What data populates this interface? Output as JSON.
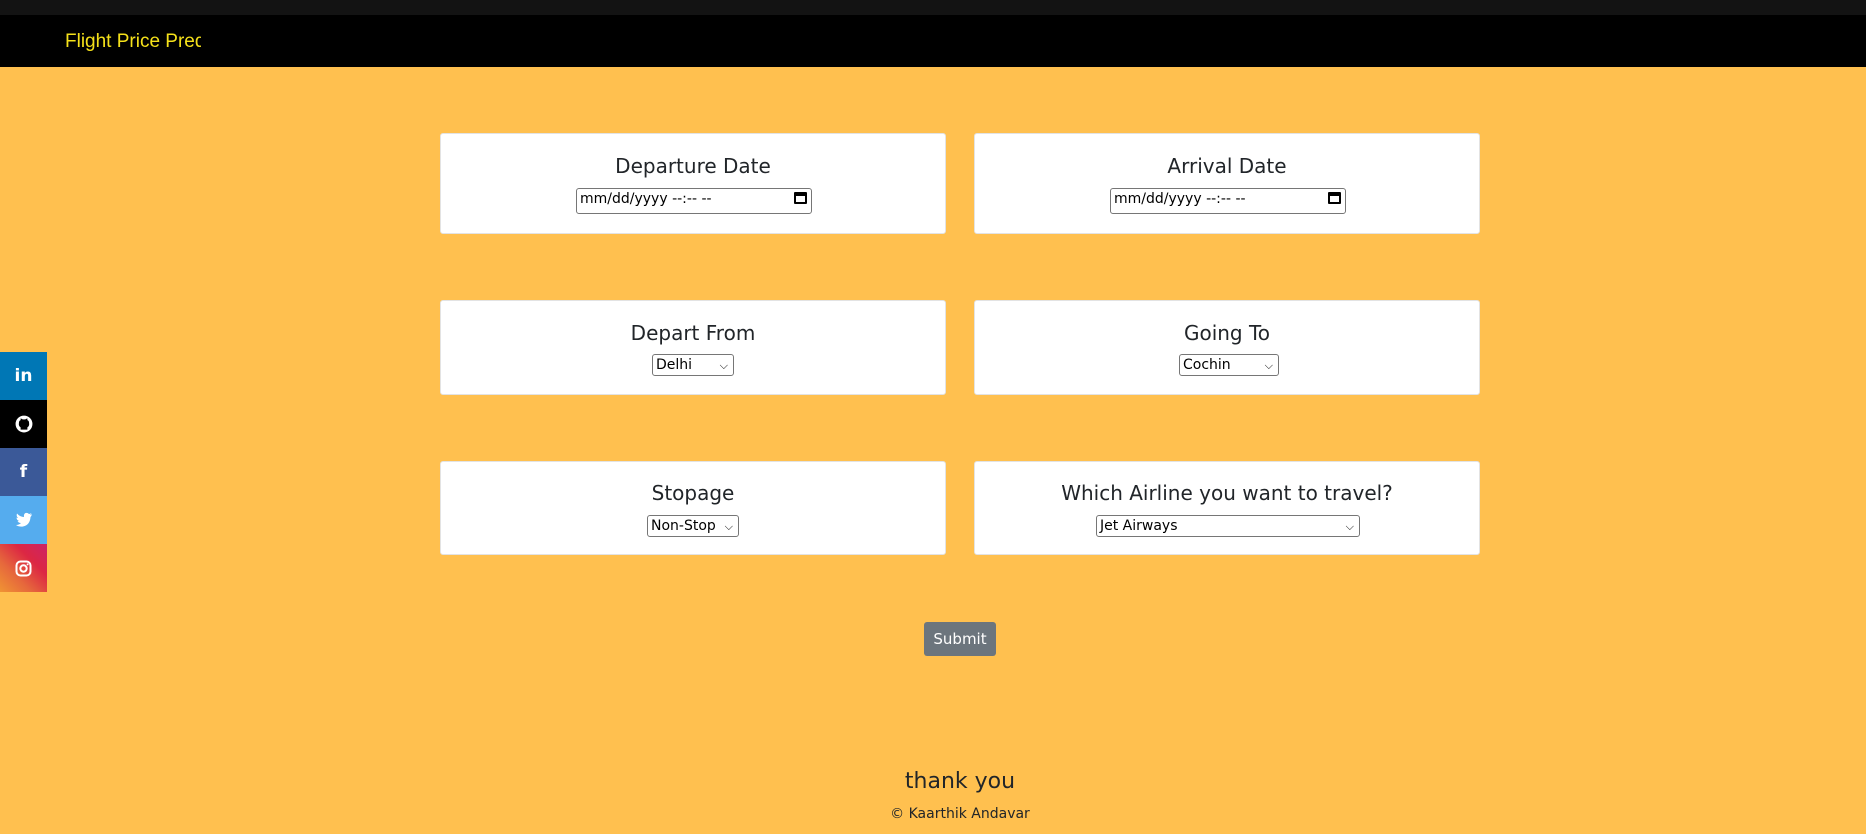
{
  "navbar": {
    "brand": "Flight Price Predi"
  },
  "social": [
    {
      "icon": "linkedin-icon",
      "glyph": "in",
      "color": "#0077B5"
    },
    {
      "icon": "github-icon",
      "glyph": "●",
      "color": "#000000"
    },
    {
      "icon": "facebook-icon",
      "glyph": "f",
      "color": "#3B5998"
    },
    {
      "icon": "twitter-icon",
      "glyph": "✉",
      "color": "#55ACEE"
    },
    {
      "icon": "instagram-icon",
      "glyph": "◎",
      "color": "#D6249F"
    }
  ],
  "form": {
    "departure": {
      "label": "Departure Date",
      "placeholder": "mm/dd/yyyy --:-- --"
    },
    "arrival": {
      "label": "Arrival Date",
      "placeholder": "mm/dd/yyyy --:-- --"
    },
    "source": {
      "label": "Depart From",
      "selected": "Delhi"
    },
    "destination": {
      "label": "Going To",
      "selected": "Cochin"
    },
    "stops": {
      "label": "Stopage",
      "selected": "Non-Stop"
    },
    "airline": {
      "label": "Which Airline you want to travel?",
      "selected": "Jet Airways"
    },
    "submit_label": "Submit"
  },
  "footer": {
    "thanks": "thank you",
    "copyright": "© Kaarthik Andavar"
  },
  "colors": {
    "background": "#FFC04F",
    "navbar": "#000000",
    "brand": "#F5E11A",
    "submit": "#6c757d"
  }
}
